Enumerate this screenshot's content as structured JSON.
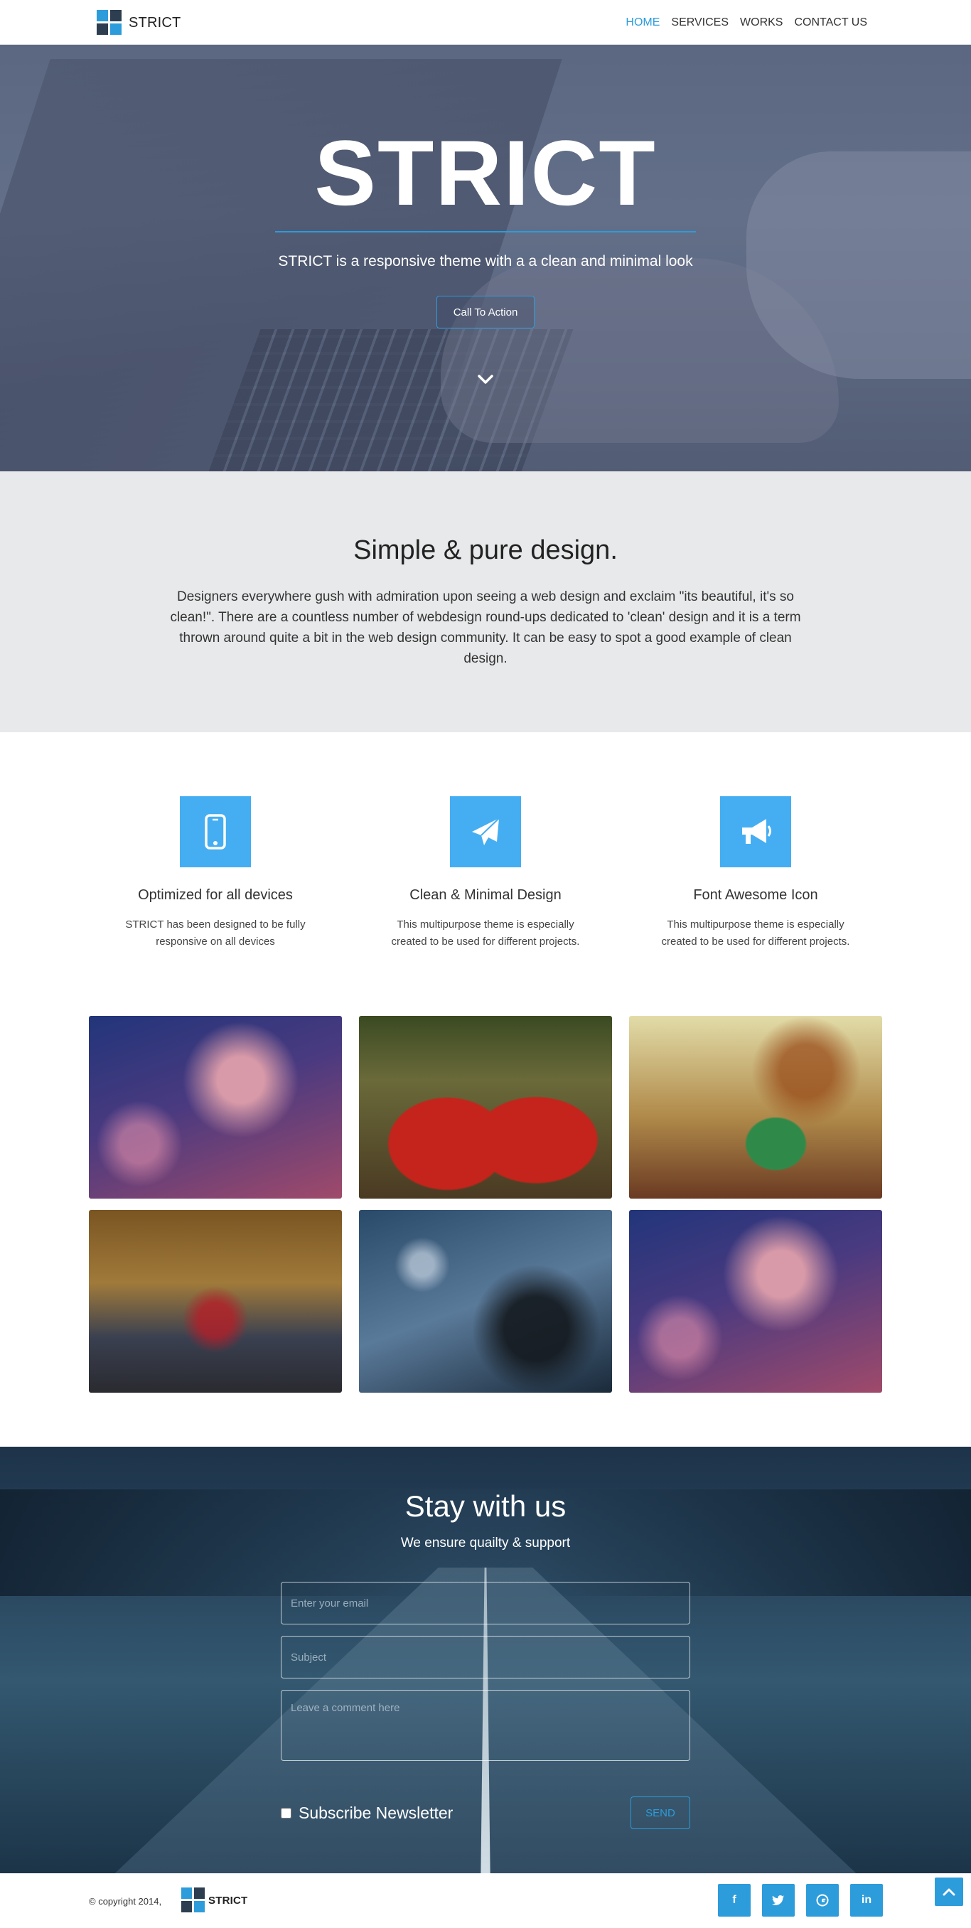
{
  "nav": {
    "brand": "STRICT",
    "links": [
      {
        "label": "HOME",
        "active": true
      },
      {
        "label": "SERVICES",
        "active": false
      },
      {
        "label": "WORKS",
        "active": false
      },
      {
        "label": "CONTACT US",
        "active": false
      }
    ]
  },
  "hero": {
    "title": "STRICT",
    "subtitle": "STRICT is a responsive theme with a a clean and minimal look",
    "cta_label": "Call To Action"
  },
  "intro": {
    "heading": "Simple & pure design.",
    "body": "Designers everywhere gush with admiration upon seeing a web design and exclaim \"its beautiful, it's so clean!\". There are a countless number of webdesign round-ups dedicated to 'clean' design and it is a term thrown around quite a bit in the web design community. It can be easy to spot a good example of clean design."
  },
  "features": [
    {
      "icon": "mobile-phone-icon",
      "title": "Optimized for all devices",
      "text": "STRICT has been designed to be fully responsive on all devices"
    },
    {
      "icon": "paper-plane-icon",
      "title": "Clean & Minimal Design",
      "text": "This multipurpose theme is especially created to be used for different projects."
    },
    {
      "icon": "bullhorn-icon",
      "title": "Font Awesome Icon",
      "text": "This multipurpose theme is especially created to be used for different projects."
    }
  ],
  "gallery": [
    {
      "subject": "woman-with-sunglasses",
      "colors": [
        "#2a3d7a",
        "#7a4a6a",
        "#c06080"
      ]
    },
    {
      "subject": "red-smiley-mugs",
      "colors": [
        "#3a4a1a",
        "#b5211a",
        "#e8e2c8"
      ]
    },
    {
      "subject": "splashing-green-cup",
      "colors": [
        "#d8d0a0",
        "#9a6a2a",
        "#3a8a4a"
      ]
    },
    {
      "subject": "red-bicycle-on-street",
      "colors": [
        "#6a4a1a",
        "#2a3040",
        "#b02030"
      ]
    },
    {
      "subject": "bicycle-on-blurred-street",
      "colors": [
        "#3a5a7a",
        "#1a2a3a",
        "#9ab0c0"
      ]
    },
    {
      "subject": "woman-with-sunglasses",
      "colors": [
        "#2a3d7a",
        "#7a4a6a",
        "#c06080"
      ]
    }
  ],
  "contact": {
    "heading": "Stay with us",
    "subheading": "We ensure quailty & support",
    "email_placeholder": "Enter your email",
    "subject_placeholder": "Subject",
    "comment_placeholder": "Leave a comment here",
    "subscribe_label": "Subscribe Newsletter",
    "send_label": "SEND"
  },
  "footer": {
    "copyright": "© copyright 2014,",
    "brand": "STRICT",
    "socials": [
      {
        "icon": "facebook-icon",
        "glyph": "f"
      },
      {
        "icon": "twitter-icon",
        "glyph": "t"
      },
      {
        "icon": "google-plus-icon",
        "glyph": "g"
      },
      {
        "icon": "linkedin-icon",
        "glyph": "in"
      }
    ]
  },
  "colors": {
    "accent": "#2d9cdb",
    "feature_icon_bg": "#45aef2",
    "intro_bg": "#e8e9ea",
    "dark": "#2c3e50"
  }
}
